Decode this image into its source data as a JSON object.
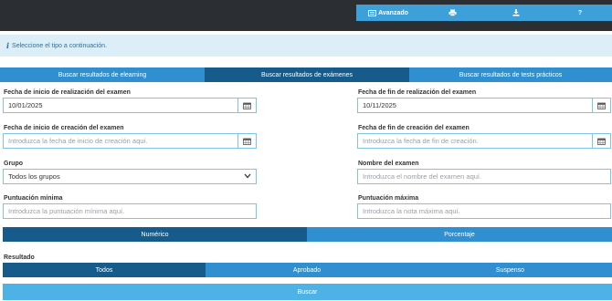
{
  "toolbar": {
    "advanced_label": "Avanzado",
    "print_icon": "printer-icon",
    "download_icon": "download-icon",
    "help_label": "?"
  },
  "info": {
    "icon": "i",
    "message": "Seleccione el tipo a continuación."
  },
  "tabs": [
    {
      "label": "Buscar resultados de elearning",
      "active": false
    },
    {
      "label": "Buscar resultados de exámenes",
      "active": true
    },
    {
      "label": "Buscar resultados de tests prácticos",
      "active": false
    }
  ],
  "form": {
    "start_exam_date": {
      "label": "Fecha de inicio de realización del examen",
      "value": "10/01/2025"
    },
    "end_exam_date": {
      "label": "Fecha de fin de realización del examen",
      "value": "10/11/2025"
    },
    "start_creation_date": {
      "label": "Fecha de inicio de creación del examen",
      "placeholder": "Introduzca la fecha de inicio de creación aquí."
    },
    "end_creation_date": {
      "label": "Fecha de fin de creación del examen",
      "placeholder": "Introduzca la fecha de fin de creación."
    },
    "group": {
      "label": "Grupo",
      "value": "Todos los grupos"
    },
    "exam_name": {
      "label": "Nombre del examen",
      "placeholder": "Introduzca el nombre del examen aquí."
    },
    "min_score": {
      "label": "Puntuación mínima",
      "placeholder": "Introduzca la puntuación mínima aquí."
    },
    "max_score": {
      "label": "Puntuación máxima",
      "placeholder": "Introduzca la nota máxima aquí."
    }
  },
  "score_type": {
    "numeric_label": "Numérico",
    "percentage_label": "Porcentaje",
    "selected": "Numérico"
  },
  "result": {
    "label": "Resultado",
    "all_label": "Todos",
    "passed_label": "Aprobado",
    "failed_label": "Suspenso",
    "selected": "Todos"
  },
  "search_label": "Buscar",
  "colors": {
    "topbar": "#2b2e33",
    "accent": "#3ea0d8",
    "tab_active": "#165b8a",
    "tab_inactive": "#2f8fd0",
    "info_bg": "#dceef8",
    "search": "#4db2e6"
  }
}
